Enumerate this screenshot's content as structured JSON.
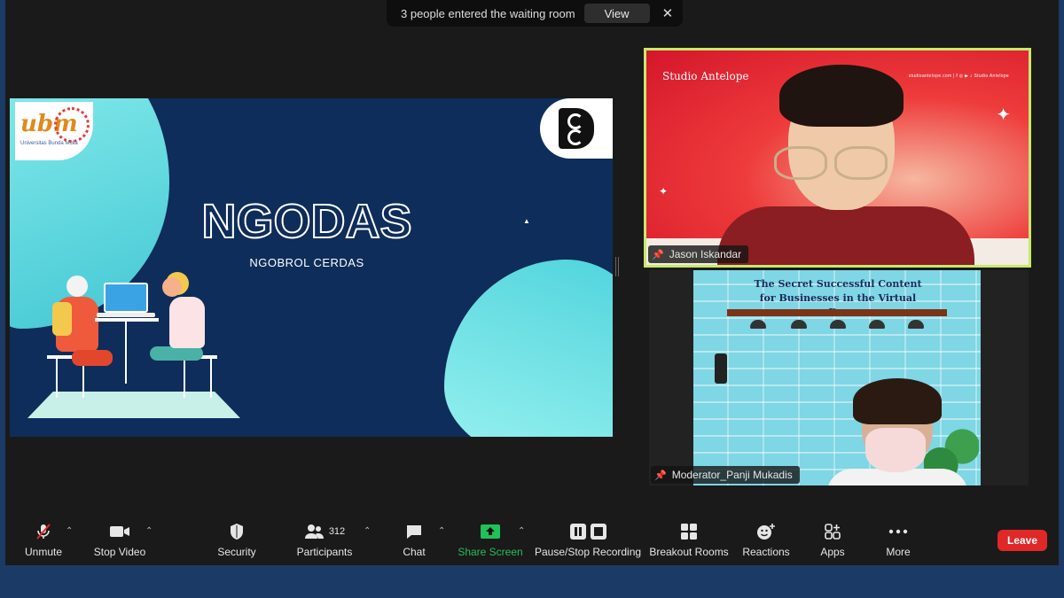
{
  "notification": {
    "message": "3 people entered the waiting room",
    "view_label": "View",
    "close_glyph": "✕"
  },
  "slide": {
    "title": "NGODAS",
    "subtitle": "NGOBROL CERDAS",
    "logo_left": "ubm",
    "logo_left_sub": "Universitas Bunda Mulia"
  },
  "participants_video": [
    {
      "name": "Jason Iskandar",
      "backdrop_brand": "Studio Antelope",
      "backdrop_right_text": "studioantelope.com  |  f  ◎  ▶  ♪  Studio Antelope",
      "active_speaker": true
    },
    {
      "name": "Moderator_Panji Mukadis",
      "backdrop_sign_line1": "The Secret Successful Content",
      "backdrop_sign_line2": "for Businesses in the Virtual Era"
    }
  ],
  "toolbar": {
    "unmute": "Unmute",
    "stop_video": "Stop Video",
    "security": "Security",
    "participants": "Participants",
    "participants_count": "312",
    "chat": "Chat",
    "share_screen": "Share Screen",
    "pause_stop_recording": "Pause/Stop Recording",
    "breakout_rooms": "Breakout Rooms",
    "reactions": "Reactions",
    "apps": "Apps",
    "more": "More",
    "leave": "Leave"
  },
  "colors": {
    "leave": "#e02828",
    "share_screen": "#20c05a",
    "active_speaker_border": "#c8e86b"
  }
}
